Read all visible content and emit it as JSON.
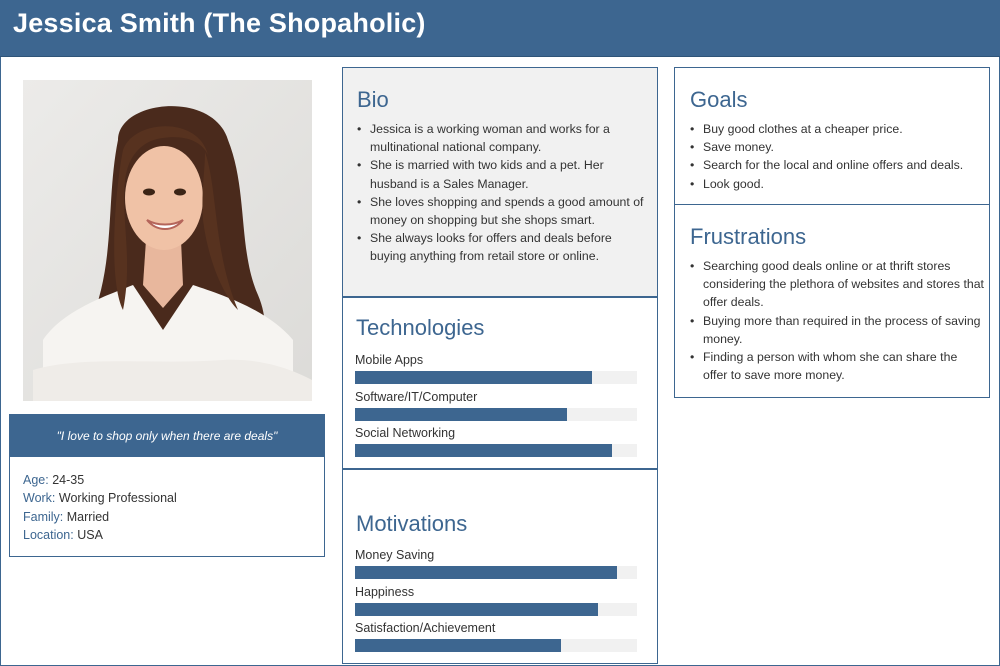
{
  "header": {
    "title": "Jessica Smith (The Shopaholic)"
  },
  "profile": {
    "quote": "\"I love to shop only when there are deals\"",
    "details": [
      {
        "key": "Age:",
        "value": "24-35"
      },
      {
        "key": "Work:",
        "value": "Working Professional"
      },
      {
        "key": "Family:",
        "value": "Married"
      },
      {
        "key": "Location:",
        "value": "USA"
      }
    ]
  },
  "bio": {
    "title": "Bio",
    "items": [
      "Jessica is a working woman and works for a multinational national company.",
      "She is married with two kids and a pet. Her husband is a Sales Manager.",
      "She loves shopping and spends a good amount of money on shopping but she shops smart.",
      "She always looks for offers and deals before buying anything from retail store or online."
    ]
  },
  "technologies": {
    "title": "Technologies",
    "items": [
      {
        "label": "Mobile Apps",
        "level": 0.84
      },
      {
        "label": "Software/IT/Computer",
        "level": 0.75
      },
      {
        "label": "Social Networking",
        "level": 0.91
      }
    ]
  },
  "motivations": {
    "title": "Motivations",
    "items": [
      {
        "label": "Money Saving",
        "level": 0.93
      },
      {
        "label": "Happiness",
        "level": 0.86
      },
      {
        "label": "Satisfaction/Achievement",
        "level": 0.73
      }
    ]
  },
  "goals": {
    "title": "Goals",
    "items": [
      "Buy good clothes at a cheaper price.",
      "Save money.",
      "Search for the local and online offers and deals.",
      "Look good."
    ]
  },
  "frustrations": {
    "title": "Frustrations",
    "items": [
      "Searching good deals online or at thrift stores considering the plethora of websites and stores that offer deals.",
      "Buying more than required in the process of saving money.",
      "Finding a person with whom she can share the offer to save more money."
    ]
  },
  "colors": {
    "accent": "#3d6690",
    "bar_track": "#f1f1f1",
    "bio_bg": "#f1f1f1"
  }
}
